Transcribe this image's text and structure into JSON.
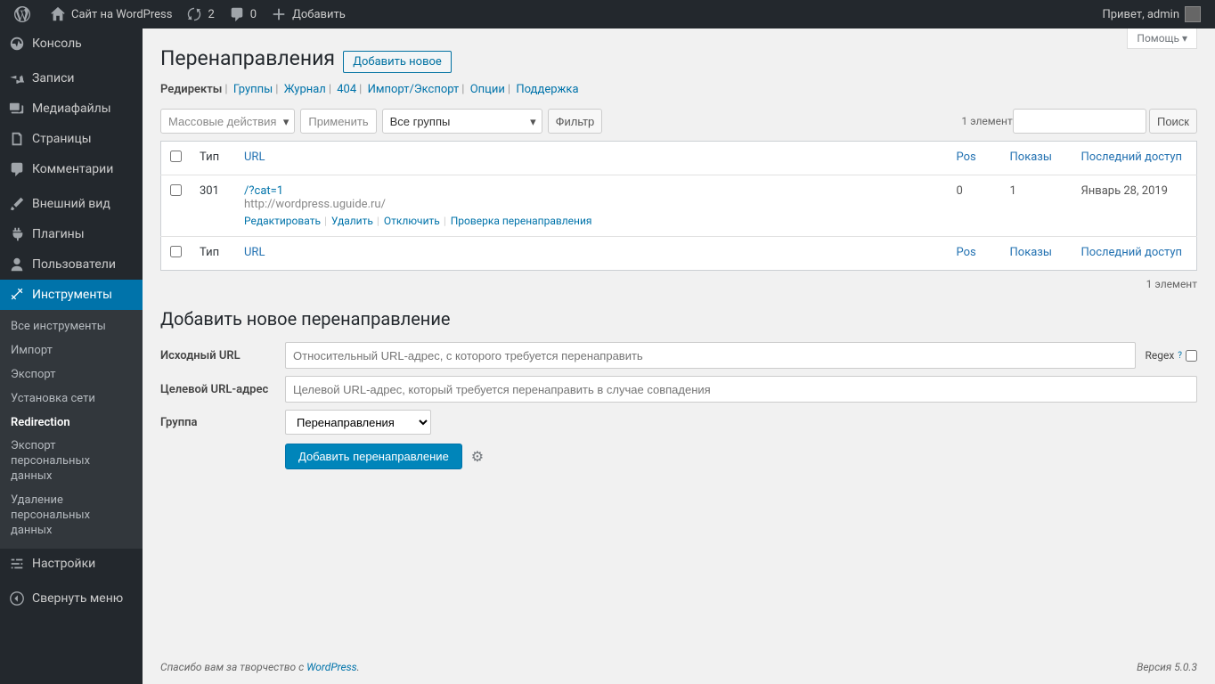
{
  "adminbar": {
    "site_name": "Сайт на WordPress",
    "updates": "2",
    "comments": "0",
    "add_new": "Добавить",
    "greeting": "Привет, admin"
  },
  "sidebar": {
    "items": [
      {
        "label": "Консоль"
      },
      {
        "label": "Записи"
      },
      {
        "label": "Медиафайлы"
      },
      {
        "label": "Страницы"
      },
      {
        "label": "Комментарии"
      },
      {
        "label": "Внешний вид"
      },
      {
        "label": "Плагины"
      },
      {
        "label": "Пользователи"
      },
      {
        "label": "Инструменты"
      },
      {
        "label": "Настройки"
      },
      {
        "label": "Свернуть меню"
      }
    ],
    "submenu": [
      "Все инструменты",
      "Импорт",
      "Экспорт",
      "Установка сети",
      "Redirection",
      "Экспорт персональных данных",
      "Удаление персональных данных"
    ]
  },
  "help_tab": "Помощь",
  "page": {
    "title": "Перенаправления",
    "add_new": "Добавить новое"
  },
  "tabs": [
    "Редиректы",
    "Группы",
    "Журнал",
    "404",
    "Импорт/Экспорт",
    "Опции",
    "Поддержка"
  ],
  "search_button": "Поиск",
  "bulk": {
    "actions_label": "Массовые действия",
    "apply": "Применить",
    "groups_label": "Все группы",
    "filter": "Фильтр"
  },
  "count_label": "1 элемент",
  "table": {
    "columns": {
      "type": "Тип",
      "url": "URL",
      "pos": "Pos",
      "hits": "Показы",
      "last": "Последний доступ"
    },
    "rows": [
      {
        "type": "301",
        "url": "/?cat=1",
        "target": "http://wordpress.uguide.ru/",
        "pos": "0",
        "hits": "1",
        "last": "Январь 28, 2019"
      }
    ],
    "actions": {
      "edit": "Редактировать",
      "delete": "Удалить",
      "disable": "Отключить",
      "check": "Проверка перенаправления"
    }
  },
  "form": {
    "title": "Добавить новое перенаправление",
    "source_label": "Исходный URL",
    "source_placeholder": "Относительный URL-адрес, с которого требуется перенаправить",
    "regex_label": "Regex",
    "target_label": "Целевой URL-адрес",
    "target_placeholder": "Целевой URL-адрес, который требуется перенаправить в случае совпадения",
    "group_label": "Группа",
    "group_value": "Перенаправления",
    "submit": "Добавить перенаправление"
  },
  "footer": {
    "thanks_prefix": "Спасибо вам за творчество с ",
    "thanks_link": "WordPress",
    "version": "Версия 5.0.3"
  }
}
